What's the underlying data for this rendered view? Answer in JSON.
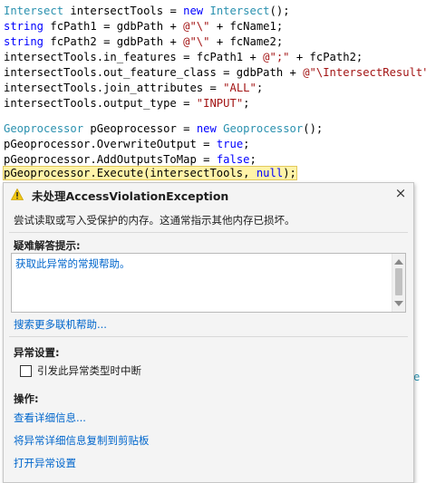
{
  "code": {
    "line1": {
      "t1": "Intersect",
      "t2": " intersectTools = ",
      "t3": "new",
      "t4": " ",
      "t5": "Intersect",
      "t6": "();"
    },
    "line2": {
      "t1": "string",
      "t2": " fcPath1 = gdbPath + ",
      "t3": "@\"\\\"",
      "t4": " + fcName1;"
    },
    "line3": {
      "t1": "string",
      "t2": " fcPath2 = gdbPath + ",
      "t3": "@\"\\\"",
      "t4": " + fcName2;"
    },
    "line4": {
      "t1": "intersectTools.in_features = fcPath1 + ",
      "t2": "@\";\"",
      "t3": " + fcPath2;"
    },
    "line5": {
      "t1": "intersectTools.out_feature_class = gdbPath + ",
      "t2": "@\"\\IntersectResult\"",
      "t3": ";"
    },
    "line6": {
      "t1": "intersectTools.join_attributes = ",
      "t2": "\"ALL\"",
      "t3": ";"
    },
    "line7": {
      "t1": "intersectTools.output_type = ",
      "t2": "\"INPUT\"",
      "t3": ";"
    },
    "line8": {
      "t1": "Geoprocessor",
      "t2": " pGeoprocessor = ",
      "t3": "new",
      "t4": " ",
      "t5": "Geoprocessor",
      "t6": "();"
    },
    "line9": {
      "t1": "pGeoprocessor.OverwriteOutput = ",
      "t2": "true",
      "t3": ";"
    },
    "line10": {
      "t1": "pGeoprocessor.AddOutputsToMap = ",
      "t2": "false",
      "t3": ";"
    },
    "line11": {
      "t1": "pGeoprocessor.Execute(intersectTools, ",
      "t2": "null",
      "t3": ");"
    },
    "stray_right": "e"
  },
  "dialog": {
    "title": "未处理AccessViolationException",
    "message": "尝试读取或写入受保护的内存。这通常指示其他内存已损坏。",
    "tips_label": "疑难解答提示:",
    "tip_link": "获取此异常的常规帮助。",
    "search_link": "搜索更多联机帮助...",
    "exception_settings_label": "异常设置:",
    "break_checkbox_label": "引发此异常类型时中断",
    "break_checked": false,
    "actions_label": "操作:",
    "action_details": "查看详细信息...",
    "action_copy": "将异常详细信息复制到剪贴板",
    "action_open_settings": "打开异常设置",
    "close_glyph": "×",
    "icon": "warning-icon"
  }
}
